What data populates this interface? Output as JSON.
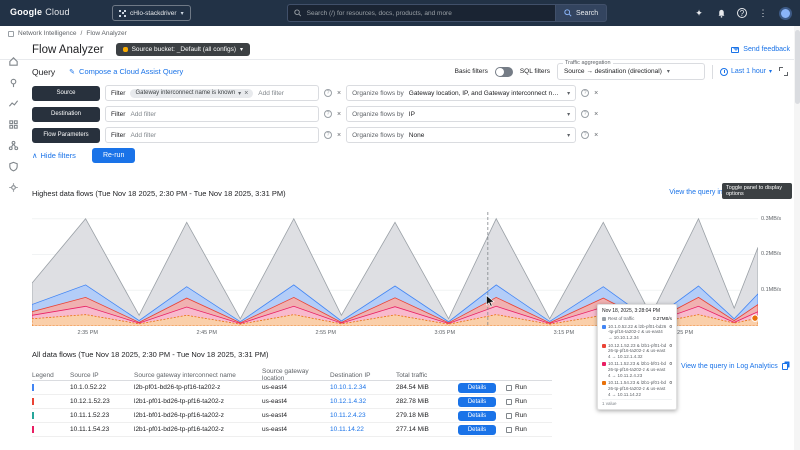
{
  "header": {
    "brand_google": "Google",
    "brand_cloud": "Cloud",
    "project_name": "cHlo-stackdriver",
    "search_placeholder": "Search (/) for resources, docs, products, and more",
    "search_button_label": "Search"
  },
  "breadcrumb": {
    "section": "Network Intelligence",
    "separator": "/",
    "page": "Flow Analyzer"
  },
  "titlebar": {
    "title": "Flow Analyzer",
    "source_bucket_label": "Source bucket: _Default (all configs)",
    "send_feedback_label": "Send feedback"
  },
  "query": {
    "section_label": "Query",
    "compose_link_label": "Compose a Cloud Assist Query",
    "basic_filters_label": "Basic filters",
    "sql_filters_label": "SQL filters",
    "traffic_aggregation_label": "Traffic aggregation",
    "traffic_aggregation_value": "Source → destination (directional)",
    "time_range_label": "Last 1 hour",
    "hide_filters_label": "Hide filters",
    "rerun_label": "Re-run",
    "rows": [
      {
        "name": "Source",
        "filter_label": "Filter",
        "filter_chip": "Gateway interconnect name is known",
        "add_filter_label": "Add filter",
        "organize_label": "Organize flows by",
        "organize_value": "Gateway location, IP, and Gateway interconnect name"
      },
      {
        "name": "Destination",
        "filter_label": "Filter",
        "filter_chip": "",
        "add_filter_label": "Add filter",
        "organize_label": "Organize flows by",
        "organize_value": "IP"
      },
      {
        "name": "Flow Parameters",
        "filter_label": "Filter",
        "filter_chip": "",
        "add_filter_label": "Add filter",
        "organize_label": "Organize flows by",
        "organize_value": "None"
      }
    ]
  },
  "chart_section": {
    "title": "Highest data flows (Tue Nov 18 2025, 2:30 PM - Tue Nov 18 2025, 3:31 PM)",
    "view_query_label": "View the query in Log Analytics",
    "hover_hint": "Toggle panel to display options"
  },
  "chart_data": {
    "type": "area",
    "title": "Highest data flows (Tue Nov 18 2025, 2:30 PM - Tue Nov 18 2025, 3:31 PM)",
    "x_range_minutes": 61,
    "ylim": [
      0,
      0.33
    ],
    "x_ticks": [
      {
        "m": 5,
        "label": "2:35 PM"
      },
      {
        "m": 15,
        "label": "2:45 PM"
      },
      {
        "m": 25,
        "label": "2:55 PM"
      },
      {
        "m": 35,
        "label": "3:05 PM"
      },
      {
        "m": 45,
        "label": "3:15 PM"
      },
      {
        "m": 55,
        "label": "3:25 PM"
      }
    ],
    "y_ticks": [
      {
        "v": 0.3,
        "label": "0.3MB/s"
      },
      {
        "v": 0.2,
        "label": "0.2MB/s"
      },
      {
        "v": 0.1,
        "label": "0.1MB/s"
      }
    ],
    "x_minutes": [
      0,
      4.5,
      9,
      13,
      17.5,
      22,
      26,
      30.5,
      35,
      39,
      43.5,
      48,
      52,
      56,
      59,
      61
    ],
    "series": [
      {
        "name": "Rest of traffic",
        "color": "#dadce0",
        "stroke": "#9aa0a6",
        "dashed": false,
        "values": [
          0.12,
          0.3,
          0.03,
          0.29,
          0.02,
          0.3,
          0.03,
          0.29,
          0.02,
          0.3,
          0.02,
          0.29,
          0.03,
          0.3,
          0.05,
          0.22
        ]
      },
      {
        "name": "10.1.0.52.22 → 10.10.1.2.34",
        "color": "#aecbfa",
        "stroke": "#4285f4",
        "dashed": false,
        "values": [
          0.06,
          0.115,
          0.015,
          0.11,
          0.012,
          0.115,
          0.014,
          0.112,
          0.012,
          0.115,
          0.013,
          0.11,
          0.014,
          0.112,
          0.02,
          0.09
        ]
      },
      {
        "name": "10.12.1.52.23 → 10.12.1.4.32",
        "color": "#f6aea9",
        "stroke": "#ea4335",
        "dashed": false,
        "values": [
          0.04,
          0.08,
          0.01,
          0.078,
          0.009,
          0.08,
          0.01,
          0.079,
          0.009,
          0.08,
          0.009,
          0.078,
          0.01,
          0.08,
          0.015,
          0.06
        ]
      },
      {
        "name": "10.11.1.52.23 → 10.11.2.4.23",
        "color": "#f8bbd0",
        "stroke": "#e91e63",
        "dashed": false,
        "values": [
          0.03,
          0.055,
          0.008,
          0.053,
          0.007,
          0.055,
          0.008,
          0.054,
          0.007,
          0.055,
          0.007,
          0.053,
          0.008,
          0.055,
          0.01,
          0.04
        ]
      },
      {
        "name": "10.11.1.54.23 → 10.11.14.22",
        "color": "#fad2a6",
        "stroke": "#e8710a",
        "dashed": true,
        "values": [
          0.02,
          0.032,
          0.006,
          0.03,
          0.005,
          0.032,
          0.006,
          0.031,
          0.005,
          0.032,
          0.005,
          0.03,
          0.006,
          0.032,
          0.008,
          0.022
        ]
      }
    ],
    "crosshair_minute": 38.3
  },
  "hover_tooltip": {
    "timestamp": "Nov 18, 2025, 3:28:04 PM",
    "rows": [
      {
        "color": "#9aa0a6",
        "label": "Rest of traffic",
        "value": "0.27MB/s"
      },
      {
        "color": "#4285f4",
        "label": "10.1.0.52.22 & l2b-pf01-bd26-tp-pf16-ta202-z & us-east4 → 10.10.1.2.34",
        "value": "0"
      },
      {
        "color": "#ea4335",
        "label": "10.12.1.52.23 & l2b1-pf01-bd26-tp-pf16-ta202-z & us-east4 → 10.12.1.4.32",
        "value": "0"
      },
      {
        "color": "#e91e63",
        "label": "10.11.1.52.23 & l2b1-bf01-bd26-tp-pf16-ta202-z & us-east4 → 10.11.2.4.23",
        "value": "0"
      },
      {
        "color": "#e8710a",
        "label": "10.11.1.54.23 & l2b1-pf01-bd26-tp-pf16-ta202-z & us-east4 → 10.11.14.22",
        "value": "0"
      }
    ],
    "footer": "1 value"
  },
  "table": {
    "title": "All data flows (Tue Nov 18 2025, 2:30 PM - Tue Nov 18 2025, 3:31 PM)",
    "view_query_label": "View the query in Log Analytics",
    "columns": [
      "Legend",
      "Source IP",
      "Source gateway interconnect name",
      "Source gateway location",
      "Destination IP",
      "Total traffic"
    ],
    "details_label": "Details",
    "run_label": "Run",
    "rows": [
      {
        "legend_color": "#aecbfa",
        "legend_stroke": "#4285f4",
        "source_ip": "10.1.0.52.22",
        "interconnect": "l2b-pf01-bd26-tp-pf16-ta202-z",
        "location": "us-east4",
        "dest_ip": "10.10.1.2.34",
        "traffic": "284.54 MiB"
      },
      {
        "legend_color": "#f6aea9",
        "legend_stroke": "#ea4335",
        "source_ip": "10.12.1.52.23",
        "interconnect": "l2b1-pf01-bd26-tp-pf16-ta202-z",
        "location": "us-east4",
        "dest_ip": "10.12.1.4.32",
        "traffic": "282.78 MiB"
      },
      {
        "legend_color": "#b2dfdb",
        "legend_stroke": "#26a69a",
        "source_ip": "10.11.1.52.23",
        "interconnect": "l2b1-bf01-bd26-tp-pf16-ta202-z",
        "location": "us-east4",
        "dest_ip": "10.11.2.4.23",
        "traffic": "279.18 MiB"
      },
      {
        "legend_color": "#f8bbd0",
        "legend_stroke": "#e91e63",
        "source_ip": "10.11.1.54.23",
        "interconnect": "l2b1-pf01-bd26-tp-pf16-ta202-z",
        "location": "us-east4",
        "dest_ip": "10.11.14.22",
        "traffic": "277.14 MiB"
      }
    ]
  },
  "glyphs": {
    "caret_down": "▾",
    "close": "×",
    "help": "?",
    "chevron_up": "∧",
    "pencil": "✎",
    "more": "⋮",
    "sparkle": "✦"
  },
  "colors": {
    "accent_blue": "#1a73e8",
    "topbar": "#223246",
    "chip_dark": "#28313d"
  }
}
